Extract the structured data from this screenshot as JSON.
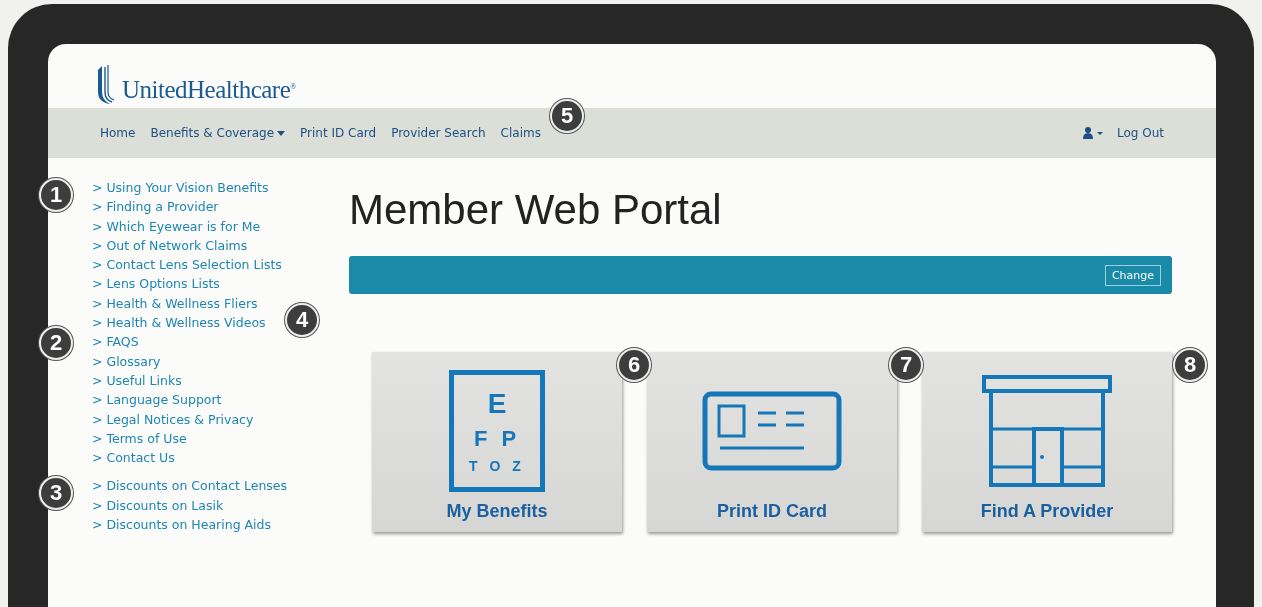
{
  "brand": {
    "name": "UnitedHealthcare",
    "mark": "®"
  },
  "nav": {
    "items": [
      {
        "label": "Home",
        "dropdown": false
      },
      {
        "label": "Benefits & Coverage",
        "dropdown": true
      },
      {
        "label": "Print ID Card",
        "dropdown": false
      },
      {
        "label": "Provider Search",
        "dropdown": false
      },
      {
        "label": "Claims",
        "dropdown": false
      }
    ],
    "logout": "Log Out"
  },
  "sidebar": {
    "groups": [
      [
        "> Using Your Vision Benefits",
        "> Finding a Provider",
        "> Which Eyewear is for Me",
        "> Out of Network Claims",
        "> Contact Lens Selection Lists",
        "> Lens Options Lists",
        "> Health & Wellness Fliers",
        "> Health & Wellness Videos",
        "> FAQS",
        "> Glossary",
        "> Useful Links",
        "> Language Support",
        "> Legal Notices & Privacy",
        "> Terms of Use",
        "> Contact Us"
      ],
      [
        "> Discounts on Contact Lenses",
        "> Discounts on Lasik",
        "> Discounts on Hearing Aids"
      ]
    ]
  },
  "main": {
    "title": "Member Web Portal",
    "change_button": "Change"
  },
  "tiles": [
    {
      "kind": "eye-chart",
      "label": "My Benefits",
      "chart_lines": [
        "E",
        "F P",
        "T O Z"
      ]
    },
    {
      "kind": "id-card",
      "label": "Print ID Card"
    },
    {
      "kind": "storefront",
      "label": "Find A Provider"
    }
  ],
  "callouts": [
    "1",
    "2",
    "3",
    "4",
    "5",
    "6",
    "7",
    "8"
  ]
}
